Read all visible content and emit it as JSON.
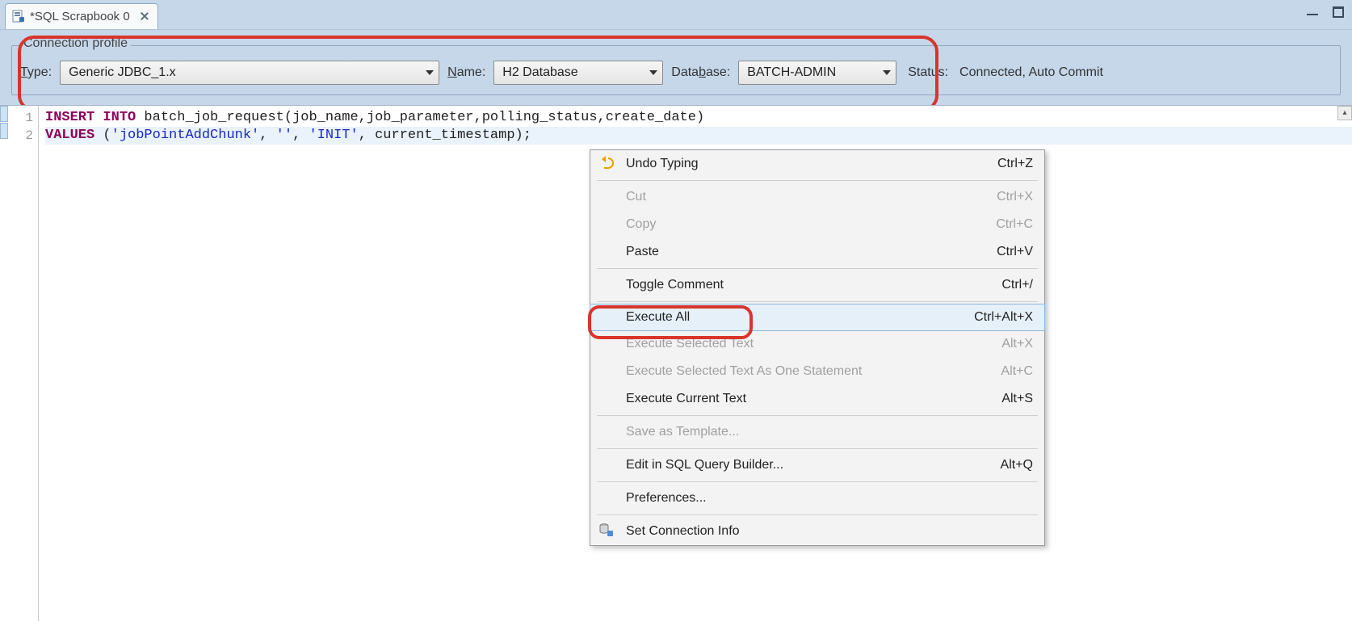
{
  "tab": {
    "title": "*SQL Scrapbook 0"
  },
  "connection": {
    "legend": "Connection profile",
    "type_label": "Type:",
    "type_value": "Generic JDBC_1.x",
    "name_label": "Name:",
    "name_value": "H2 Database",
    "database_label": "Database:",
    "database_value": "BATCH-ADMIN",
    "status_label": "Status:",
    "status_value": "Connected, Auto Commit"
  },
  "code": {
    "line1": {
      "kw1": "INSERT",
      "kw2": "INTO",
      "rest": " batch_job_request(job_name,job_parameter,polling_status,create_date)"
    },
    "line2": {
      "kw1": "VALUES",
      "p1": " (",
      "s1": "'jobPointAddChunk'",
      "c1": ", ",
      "s2": "''",
      "c2": ", ",
      "s3": "'INIT'",
      "c3": ", current_timestamp);"
    },
    "lineno1": "1",
    "lineno2": "2"
  },
  "menu": {
    "undo": {
      "label": "Undo Typing",
      "shortcut": "Ctrl+Z"
    },
    "cut": {
      "label": "Cut",
      "shortcut": "Ctrl+X"
    },
    "copy": {
      "label": "Copy",
      "shortcut": "Ctrl+C"
    },
    "paste": {
      "label": "Paste",
      "shortcut": "Ctrl+V"
    },
    "toggle_comment": {
      "label": "Toggle Comment",
      "shortcut": "Ctrl+/"
    },
    "execute_all": {
      "label": "Execute All",
      "shortcut": "Ctrl+Alt+X"
    },
    "execute_selected": {
      "label": "Execute Selected Text",
      "shortcut": "Alt+X"
    },
    "execute_selected_one": {
      "label": "Execute Selected Text As One Statement",
      "shortcut": "Alt+C"
    },
    "execute_current": {
      "label": "Execute Current Text",
      "shortcut": "Alt+S"
    },
    "save_template": {
      "label": "Save as Template...",
      "shortcut": ""
    },
    "edit_builder": {
      "label": "Edit in SQL Query Builder...",
      "shortcut": "Alt+Q"
    },
    "preferences": {
      "label": "Preferences...",
      "shortcut": ""
    },
    "set_conn": {
      "label": "Set Connection Info",
      "shortcut": ""
    }
  }
}
